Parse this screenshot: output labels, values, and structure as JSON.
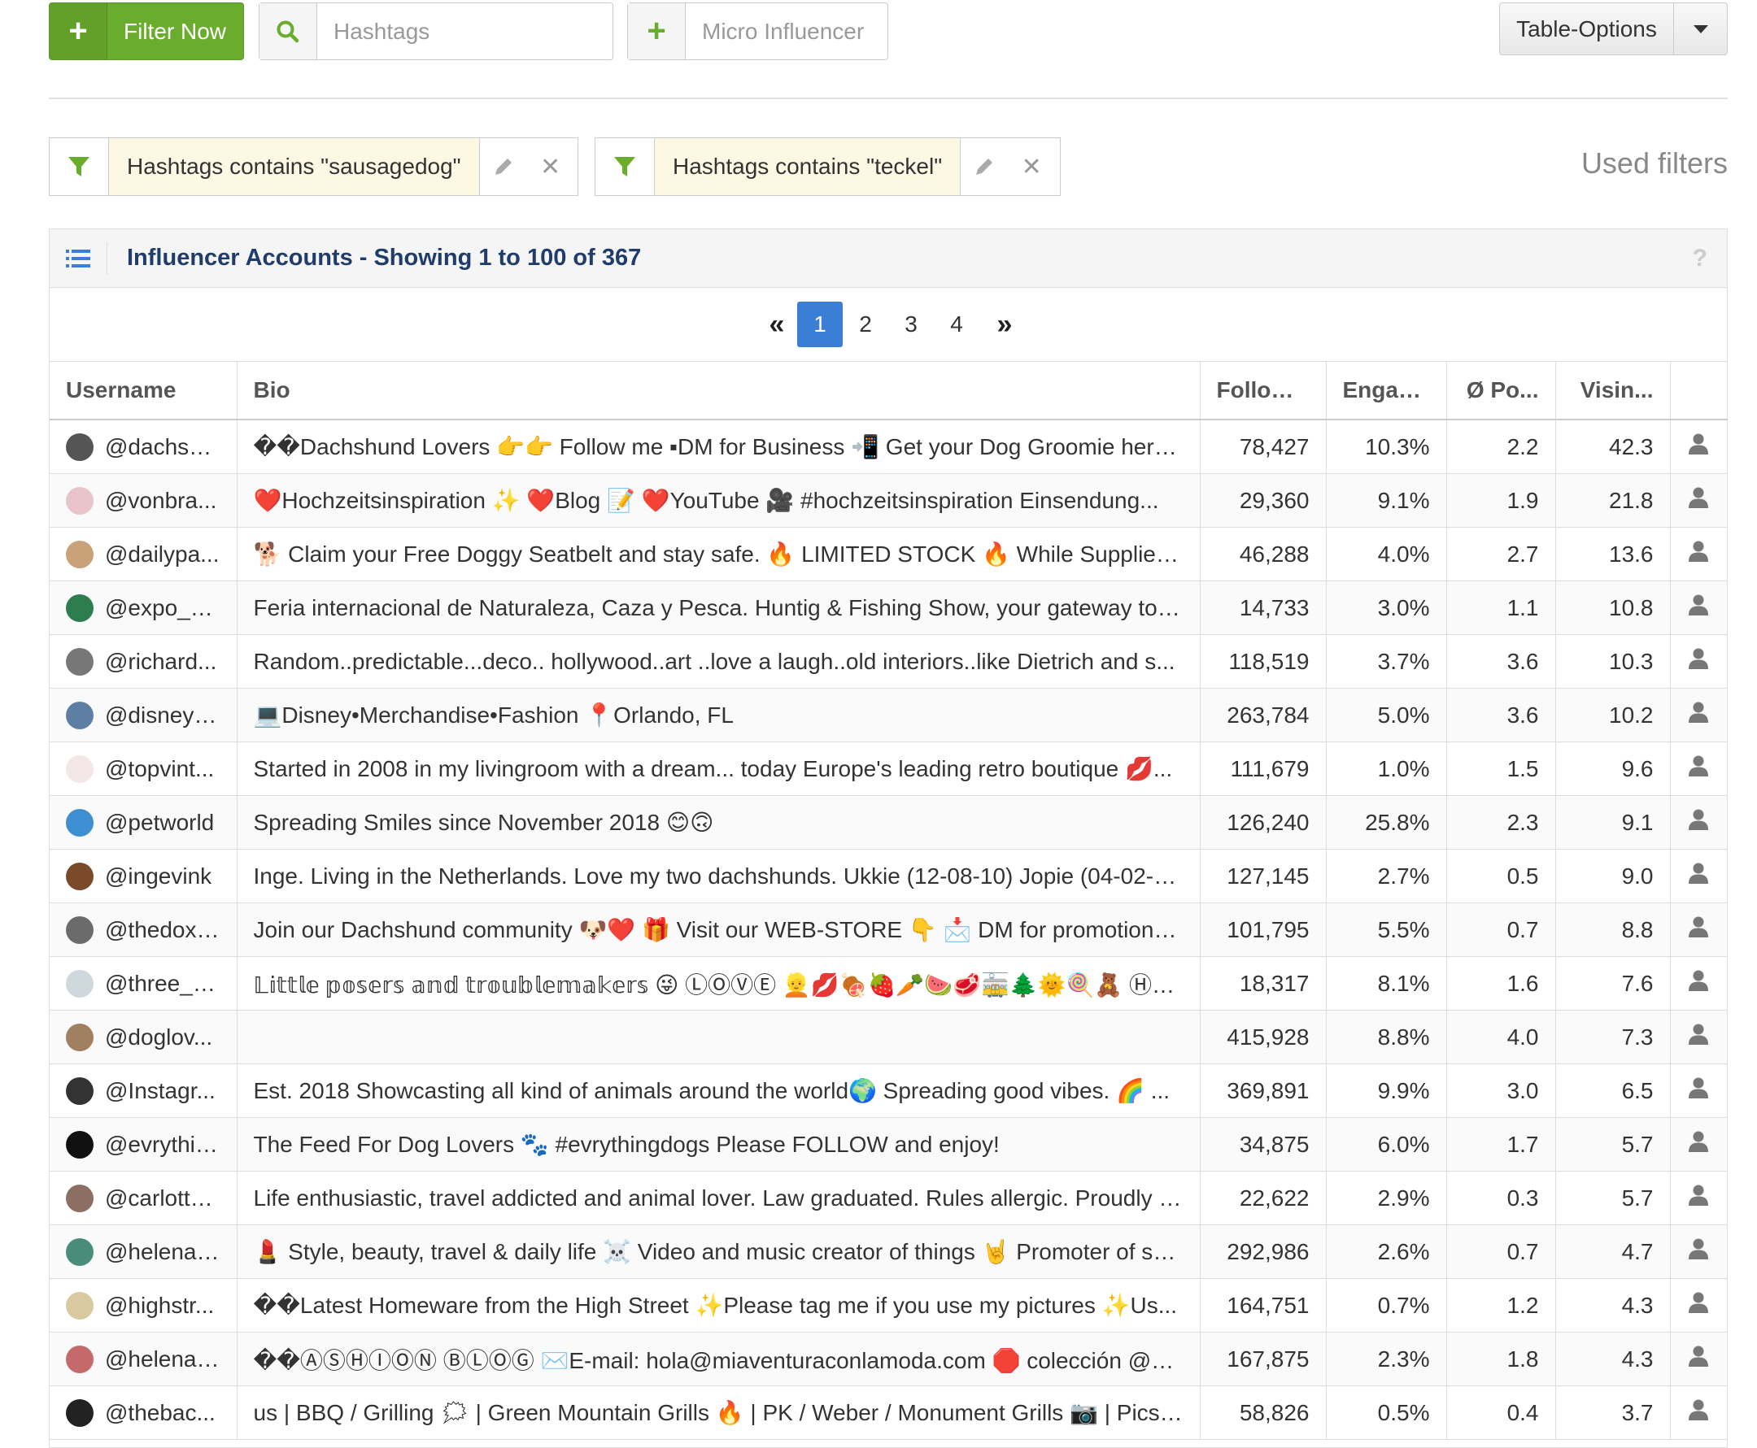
{
  "toolbar": {
    "filter_now_label": "Filter Now",
    "hashtags_placeholder": "Hashtags",
    "micro_influencer_placeholder": "Micro Influencer",
    "table_options_label": "Table-Options"
  },
  "filters": {
    "chips": [
      {
        "text": "Hashtags contains \"sausagedog\""
      },
      {
        "text": "Hashtags contains \"teckel\""
      }
    ],
    "used_filters_label": "Used filters"
  },
  "panel": {
    "title": "Influencer Accounts - Showing 1 to 100 of 367",
    "help": "?"
  },
  "pagination": {
    "first": "«",
    "last": "»",
    "pages": [
      "1",
      "2",
      "3",
      "4"
    ],
    "current": "1"
  },
  "table": {
    "columns": {
      "username": "Username",
      "bio": "Bio",
      "follower": "Follower",
      "engagement": "Engag...",
      "avg_posts": "Ø Po...",
      "visibility": "Visin..."
    },
    "rows": [
      {
        "username": "@dachsh...",
        "bio": "��Dachshund Lovers 👉👉 Follow me ▪DM for Business 📲 Get your Dog Groomie here...",
        "follower": "78,427",
        "engagement": "10.3%",
        "avg_posts": "2.2",
        "visibility": "42.3",
        "avatar_color": "#555555"
      },
      {
        "username": "@vonbra...",
        "bio": "❤️Hochzeitsinspiration ✨ ❤️Blog 📝 ❤️YouTube 🎥 #hochzeitsinspiration Einsendung...",
        "follower": "29,360",
        "engagement": "9.1%",
        "avg_posts": "1.9",
        "visibility": "21.8",
        "avatar_color": "#e8c4c8"
      },
      {
        "username": "@dailypa...",
        "bio": "🐕 Claim your Free Doggy Seatbelt and stay safe. 🔥 LIMITED STOCK 🔥 While Supplies la...",
        "follower": "46,288",
        "engagement": "4.0%",
        "avg_posts": "2.7",
        "visibility": "13.6",
        "avatar_color": "#c9a27a"
      },
      {
        "username": "@expo_ci...",
        "bio": "Feria internacional de Naturaleza, Caza y Pesca. Huntig & Fishing Show, your gateway to h...",
        "follower": "14,733",
        "engagement": "3.0%",
        "avg_posts": "1.1",
        "visibility": "10.8",
        "avatar_color": "#2e7d4f"
      },
      {
        "username": "@richard...",
        "bio": "Random..predictable...deco.. hollywood..art ..love a laugh..old interiors..like Dietrich and s...",
        "follower": "118,519",
        "engagement": "3.7%",
        "avg_posts": "3.6",
        "visibility": "10.3",
        "avatar_color": "#777777"
      },
      {
        "username": "@disneyli...",
        "bio": "💻Disney•Merchandise•Fashion 📍Orlando, FL",
        "follower": "263,784",
        "engagement": "5.0%",
        "avg_posts": "3.6",
        "visibility": "10.2",
        "avatar_color": "#5c7fa3"
      },
      {
        "username": "@topvint...",
        "bio": "Started in 2008 in my livingroom with a dream... today Europe's leading retro boutique 💋...",
        "follower": "111,679",
        "engagement": "1.0%",
        "avg_posts": "1.5",
        "visibility": "9.6",
        "avatar_color": "#f3e6e6"
      },
      {
        "username": "@petworld",
        "bio": "Spreading Smiles since November 2018 😊🙃",
        "follower": "126,240",
        "engagement": "25.8%",
        "avg_posts": "2.3",
        "visibility": "9.1",
        "avatar_color": "#3d8fd1"
      },
      {
        "username": "@ingevink",
        "bio": "Inge. Living in the Netherlands. Love my two dachshunds. Ukkie (12-08-10) Jopie (04-02-1...",
        "follower": "127,145",
        "engagement": "2.7%",
        "avg_posts": "0.5",
        "visibility": "9.0",
        "avatar_color": "#7a4a2a"
      },
      {
        "username": "@thedoxi...",
        "bio": "Join our Dachshund community 🐶❤️ 🎁 Visit our WEB-STORE 👇 📩 DM for promotions ...",
        "follower": "101,795",
        "engagement": "5.5%",
        "avg_posts": "0.7",
        "visibility": "8.8",
        "avatar_color": "#6b6b6b"
      },
      {
        "username": "@three_d...",
        "bio": "𝕃𝕚𝕥𝕥𝕝𝕖 𝕡𝕠𝕤𝕖𝕣𝕤 𝕒𝕟𝕕 𝕥𝕣𝕠𝕦𝕓𝕝𝕖𝕞𝕒𝕜𝕖𝕣𝕤 😜 ⓁⓄⓋⒺ 👱💋🍖🍓🥕🍉🥩🚋🌲🌞🍭🧸 ⒽⒶ...",
        "follower": "18,317",
        "engagement": "8.1%",
        "avg_posts": "1.6",
        "visibility": "7.6",
        "avatar_color": "#cfd8dc"
      },
      {
        "username": "@doglov...",
        "bio": "",
        "follower": "415,928",
        "engagement": "8.8%",
        "avg_posts": "4.0",
        "visibility": "7.3",
        "avatar_color": "#a08060"
      },
      {
        "username": "@Instagr...",
        "bio": "Est. 2018 Showcasting all kind of animals around the world🌍 Spreading good vibes. 🌈 ...",
        "follower": "369,891",
        "engagement": "9.9%",
        "avg_posts": "3.0",
        "visibility": "6.5",
        "avatar_color": "#333333"
      },
      {
        "username": "@evrythin...",
        "bio": "The Feed For Dog Lovers 🐾 #evrythingdogs Please FOLLOW and enjoy!",
        "follower": "34,875",
        "engagement": "6.0%",
        "avg_posts": "1.7",
        "visibility": "5.7",
        "avatar_color": "#111111"
      },
      {
        "username": "@carlotta...",
        "bio": "Life enthusiastic, travel addicted and animal lover. Law graduated. Rules allergic. Proudly I...",
        "follower": "22,622",
        "engagement": "2.9%",
        "avg_posts": "0.3",
        "visibility": "5.7",
        "avatar_color": "#8d6e63"
      },
      {
        "username": "@helenan...",
        "bio": "💄 Style, beauty, travel & daily life ☠️ Video and music creator of things 🤘 Promoter of sel...",
        "follower": "292,986",
        "engagement": "2.6%",
        "avg_posts": "0.7",
        "visibility": "4.7",
        "avatar_color": "#4a8c7a"
      },
      {
        "username": "@highstr...",
        "bio": "��Latest Homeware from the High Street ✨Please tag me if you use my pictures ✨Us...",
        "follower": "164,751",
        "engagement": "0.7%",
        "avg_posts": "1.2",
        "visibility": "4.3",
        "avatar_color": "#d8c9a0"
      },
      {
        "username": "@helenac...",
        "bio": "��ⒶⓈⒽⒾⓄⓃ ⒷⓁⓄⒼ ✉️E-mail: hola@miaventuraconlamoda.com 🛑 colección @mai...",
        "follower": "167,875",
        "engagement": "2.3%",
        "avg_posts": "1.8",
        "visibility": "4.3",
        "avatar_color": "#c46a6a"
      },
      {
        "username": "@thebac...",
        "bio": "us | BBQ / Grilling 🗯 | Green Mountain Grills 🔥 | PK / Weber / Monument Grills 📷 | Pics ...",
        "follower": "58,826",
        "engagement": "0.5%",
        "avg_posts": "0.4",
        "visibility": "3.7",
        "avatar_color": "#222222"
      }
    ]
  },
  "colors": {
    "accent_green": "#6aac2e",
    "title_blue": "#1f3c6b",
    "pager_active": "#3a7fd5",
    "chip_bg": "#fcf8e3"
  },
  "icons": {
    "filter_now": "plus-icon",
    "hashtags": "search-icon",
    "micro_influencer": "plus-icon",
    "chip": "funnel-icon",
    "chip_edit": "pencil-icon",
    "chip_remove": "close-icon",
    "panel": "list-icon",
    "row_action": "user-icon"
  }
}
